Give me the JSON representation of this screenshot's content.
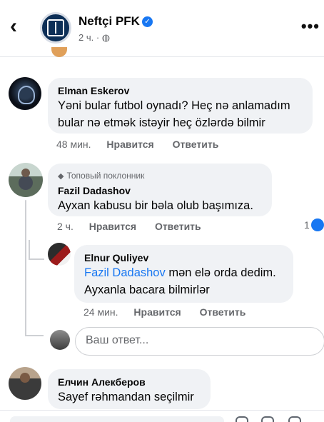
{
  "header": {
    "back_icon": "chevron-left-icon",
    "page_name": "Neftçi PFK",
    "verified_icon": "verified-badge-icon",
    "meta_time": "2 ч.",
    "meta_audience_icon": "globe-icon",
    "more_icon": "more-dots-icon"
  },
  "comments": [
    {
      "author": "Elman Eskerov",
      "text_line1": "Yəni bular futbol oynadı? Heç nə anlamadım",
      "text_line2": "bular nə etmək istəyir heç özlərdə bilmir",
      "time": "48 мин.",
      "like": "Нравится",
      "reply": "Ответить"
    },
    {
      "badge": "Топовый поклонник",
      "author": "Fazil Dadashov",
      "text": "Ayxan kabusu bir bəla olub başımıza.",
      "time": "2 ч.",
      "like": "Нравится",
      "reply": "Ответить",
      "reaction_count": "1",
      "reaction_icon": "like-reaction-icon"
    }
  ],
  "reply": {
    "author": "Elnur Quliyev",
    "mention": "Fazil Dadashov",
    "text_rest": " mən elə orda dedim.",
    "text_line2": "Ayxanla bacara bilmirlər",
    "time": "24 мин.",
    "like": "Нравится",
    "reply": "Ответить"
  },
  "reply_input": {
    "placeholder": "Ваш ответ..."
  },
  "last_comment": {
    "author": "Елчин Алекберов",
    "text": "Sayef rəhmandan seçilmir"
  }
}
